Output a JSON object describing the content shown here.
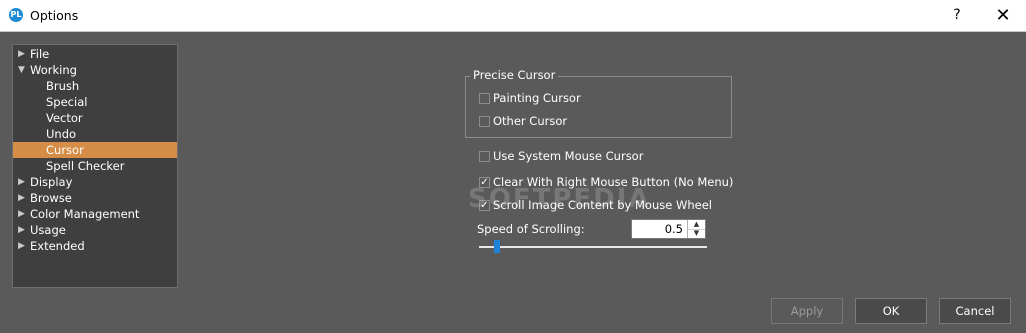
{
  "window": {
    "title": "Options",
    "icon_label": "PL",
    "help_label": "?",
    "close_label": "✕"
  },
  "tree": {
    "items": [
      {
        "label": "File",
        "expanded": false,
        "has_children": true,
        "level": 0
      },
      {
        "label": "Working",
        "expanded": true,
        "has_children": true,
        "level": 0
      },
      {
        "label": "Brush",
        "level": 1
      },
      {
        "label": "Special",
        "level": 1
      },
      {
        "label": "Vector",
        "level": 1
      },
      {
        "label": "Undo",
        "level": 1
      },
      {
        "label": "Cursor",
        "level": 1,
        "selected": true
      },
      {
        "label": "Spell Checker",
        "level": 1
      },
      {
        "label": "Display",
        "expanded": false,
        "has_children": true,
        "level": 0
      },
      {
        "label": "Browse",
        "expanded": false,
        "has_children": true,
        "level": 0
      },
      {
        "label": "Color Management",
        "expanded": false,
        "has_children": true,
        "level": 0
      },
      {
        "label": "Usage",
        "expanded": false,
        "has_children": true,
        "level": 0
      },
      {
        "label": "Extended",
        "expanded": false,
        "has_children": true,
        "level": 0
      }
    ]
  },
  "precise_cursor": {
    "title": "Precise Cursor",
    "painting_cursor": {
      "label": "Painting Cursor",
      "checked": false
    },
    "other_cursor": {
      "label": "Other Cursor",
      "checked": false
    }
  },
  "options": {
    "use_system_mouse_cursor": {
      "label": "Use System Mouse Cursor",
      "checked": false
    },
    "clear_with_right_mouse": {
      "label": "Clear With Right Mouse Button (No Menu)",
      "checked": true
    },
    "scroll_image_content": {
      "label": "Scroll Image Content by Mouse Wheel",
      "checked": true
    }
  },
  "scrolling": {
    "label": "Speed of Scrolling:",
    "value": "0.5",
    "slider_fraction": 0.08
  },
  "buttons": {
    "apply": "Apply",
    "ok": "OK",
    "cancel": "Cancel"
  },
  "watermark": "SOFTPEDIA",
  "colors": {
    "selection": "#d58d48",
    "background": "#5a5a5a",
    "tree_background": "#3f3f3f",
    "slider_thumb": "#1f84d8"
  }
}
